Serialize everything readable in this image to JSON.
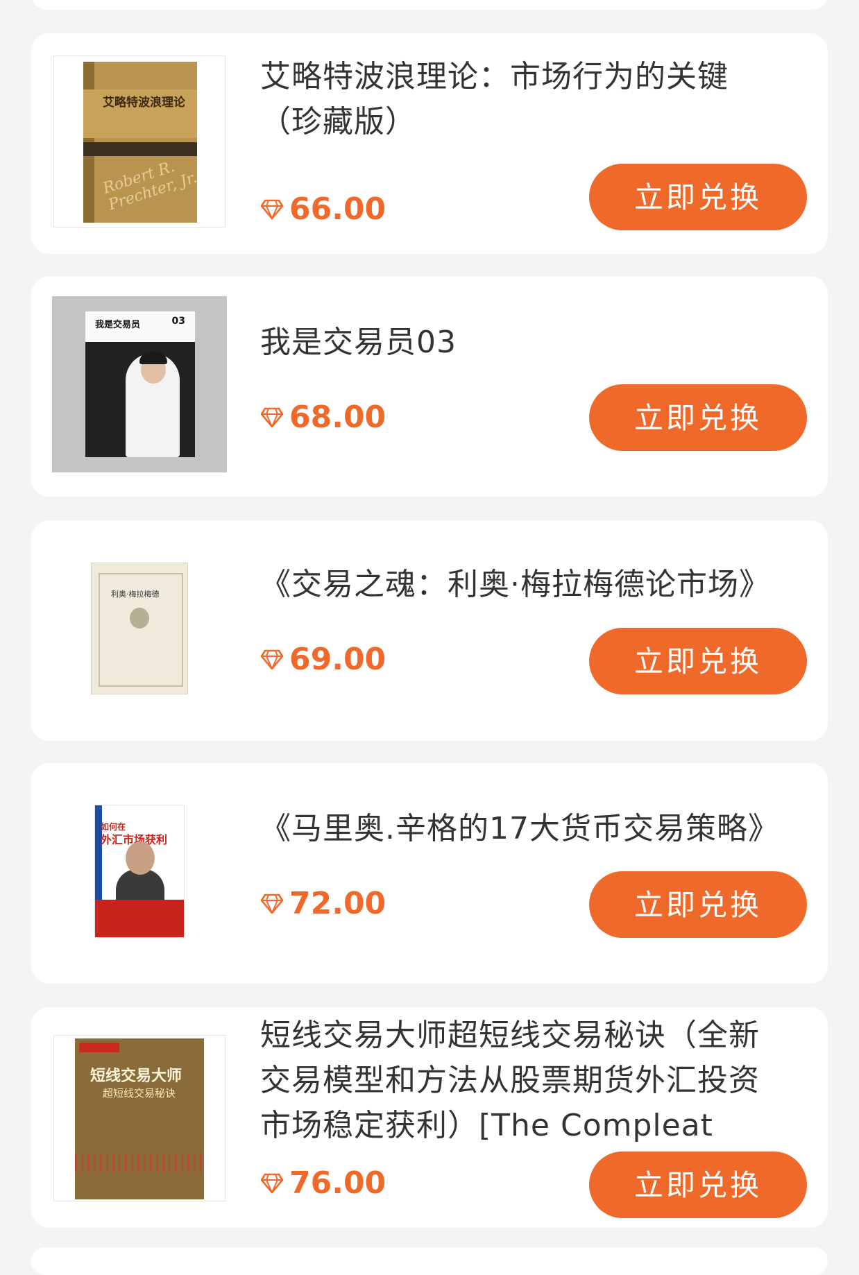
{
  "products": [
    {
      "title": "艾略特波浪理论：市场行为的关键（珍藏版）",
      "price": "66.00",
      "button_label": "立即兑换",
      "cover": {
        "text": "艾略特波浪理论",
        "script": "Robert R. Prechter, Jr."
      }
    },
    {
      "title": "我是交易员03",
      "price": "68.00",
      "button_label": "立即兑换",
      "cover": {
        "text": "我是交易员",
        "number": "03"
      }
    },
    {
      "title": "《交易之魂：利奥·梅拉梅德论市场》",
      "price": "69.00",
      "button_label": "立即兑换",
      "cover": {
        "text": "利奥·梅拉梅德"
      }
    },
    {
      "title": "《马里奥.辛格的17大货币交易策略》",
      "price": "72.00",
      "button_label": "立即兑换",
      "cover": {
        "text_small": "如何在",
        "text": "外汇市场获利"
      }
    },
    {
      "title": "短线交易大师超短线交易秘诀（全新交易模型和方法从股票期货外汇投资市场稳定获利）[The Compleat Day",
      "price": "76.00",
      "button_label": "立即兑换",
      "cover": {
        "text": "短线交易大师",
        "sub": "超短线交易秘诀"
      }
    }
  ],
  "colors": {
    "accent": "#ef6a2a",
    "background": "#f4f4f4",
    "card": "#ffffff",
    "title_text": "#333333"
  },
  "icons": {
    "price": "diamond-icon"
  }
}
